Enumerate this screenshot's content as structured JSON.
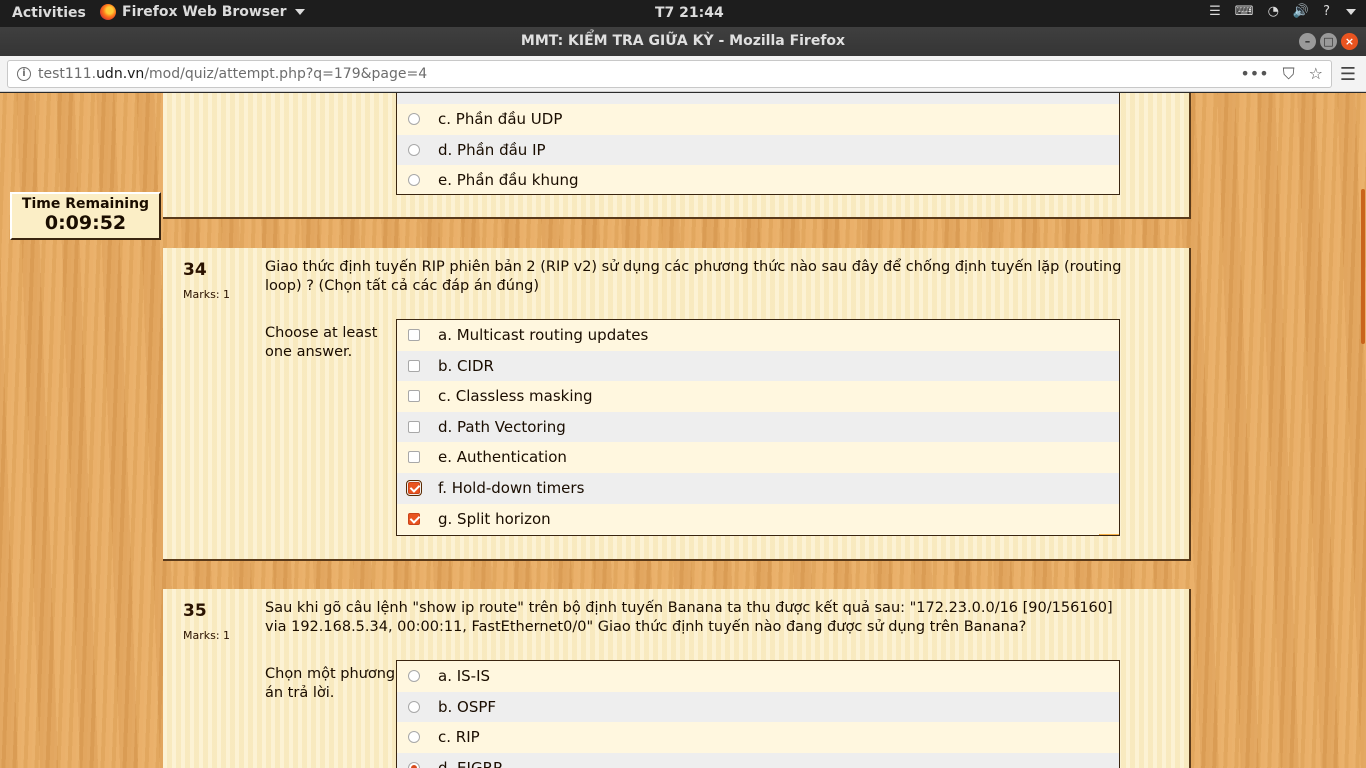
{
  "system": {
    "activities": "Activities",
    "app_name": "Firefox Web Browser",
    "clock": "T7 21:44"
  },
  "window": {
    "title": "MMT: KIỂM TRA GIỮA KỲ - Mozilla Firefox"
  },
  "urlbar": {
    "host_prefix": "test111.",
    "host": "udn.vn",
    "path": "/mod/quiz/attempt.php?q=179&page=4"
  },
  "timer": {
    "label": "Time Remaining",
    "value": "0:09:52"
  },
  "prev_question": {
    "answers": [
      {
        "label": "c. Phần đầu UDP",
        "checked": false
      },
      {
        "label": "d. Phần đầu IP",
        "checked": false
      },
      {
        "label": "e. Phần đầu khung",
        "checked": false
      }
    ]
  },
  "q34": {
    "number": "34",
    "marks": "Marks: 1",
    "text": "Giao thức định tuyến RIP phiên bản 2 (RIP v2) sử dụng các phương thức nào sau đây để chống định tuyến lặp (routing loop) ? (Chọn tất cả các đáp án đúng)",
    "prompt": "Choose at least one answer.",
    "answers": [
      {
        "label": "a. Multicast routing updates",
        "checked": false
      },
      {
        "label": "b. CIDR",
        "checked": false
      },
      {
        "label": "c. Classless masking",
        "checked": false
      },
      {
        "label": "d. Path Vectoring",
        "checked": false
      },
      {
        "label": "e. Authentication",
        "checked": false
      },
      {
        "label": "f. Hold-down timers",
        "checked": true
      },
      {
        "label": "g. Split horizon",
        "checked": true
      }
    ]
  },
  "q35": {
    "number": "35",
    "marks": "Marks: 1",
    "text": "Sau khi gõ câu lệnh \"show ip route\" trên bộ định tuyến Banana ta thu được kết quả sau: \"172.23.0.0/16 [90/156160] via 192.168.5.34, 00:00:11, FastEthernet0/0\" Giao thức định tuyến nào đang được sử dụng trên Banana?",
    "prompt": "Chọn một phương án trả lời.",
    "answers": [
      {
        "label": "a. IS-IS",
        "checked": false
      },
      {
        "label": "b. OSPF",
        "checked": false
      },
      {
        "label": "c. RIP",
        "checked": false
      },
      {
        "label": "d. EIGRP",
        "checked": true
      }
    ]
  }
}
